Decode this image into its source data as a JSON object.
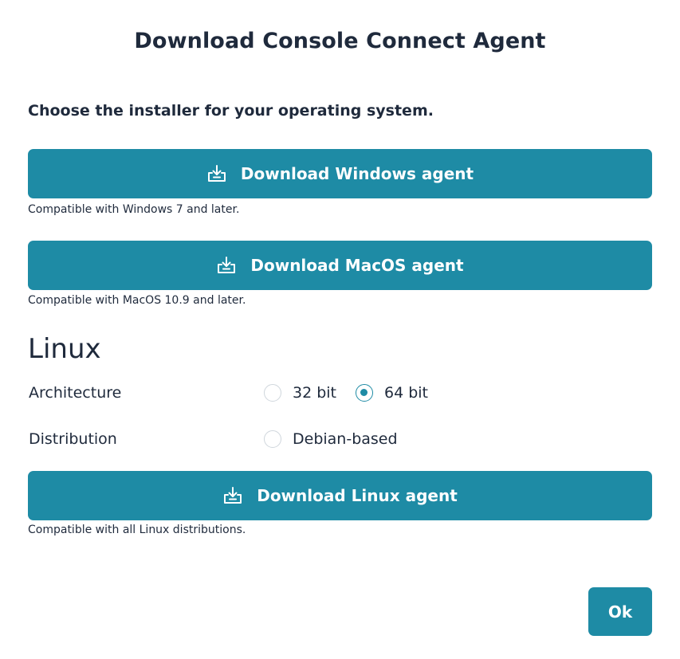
{
  "dialog": {
    "title": "Download Console Connect Agent",
    "subtitle": "Choose the installer for your operating system."
  },
  "windows": {
    "button_label": "Download Windows agent",
    "note": "Compatible with Windows 7 and later."
  },
  "macos": {
    "button_label": "Download MacOS agent",
    "note": "Compatible with MacOS 10.9 and later."
  },
  "linux": {
    "heading": "Linux",
    "architecture_label": "Architecture",
    "architecture_options": [
      {
        "label": "32 bit",
        "selected": false
      },
      {
        "label": "64 bit",
        "selected": true
      }
    ],
    "distribution_label": "Distribution",
    "distribution_options": [
      {
        "label": "Debian-based",
        "selected": false
      }
    ],
    "button_label": "Download Linux agent",
    "note": "Compatible with all Linux distributions."
  },
  "footer": {
    "ok_label": "Ok"
  },
  "icons": {
    "download": "download-tray-icon"
  },
  "colors": {
    "accent": "#1e8ba5",
    "text": "#1f2a3c"
  }
}
